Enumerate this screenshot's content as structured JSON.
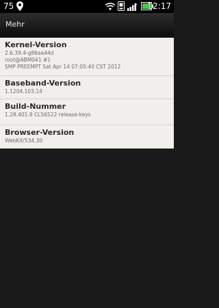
{
  "statusbar": {
    "notification": "75",
    "time": "12:17"
  },
  "titlebar": {
    "title": "Mehr"
  },
  "items": [
    {
      "title": "Kernel-Version",
      "lines": [
        "2.6.39.4-g86aa44d",
        "root@ABM041 #1",
        "SMP PREEMPT Sat Apr 14 07:05:40 CST 2012"
      ]
    },
    {
      "title": "Baseband-Version",
      "lines": [
        "1.1204.103.14"
      ]
    },
    {
      "title": "Build-Nummer",
      "lines": [
        "1.28.401.9 CL56522 release-keys"
      ]
    },
    {
      "title": "Browser-Version",
      "lines": [
        "WebKit/534.30"
      ]
    }
  ],
  "colors": {
    "list_bg": "#f1efec",
    "screen_bg": "#1a1a1a",
    "battery": "#3ecf3e"
  }
}
